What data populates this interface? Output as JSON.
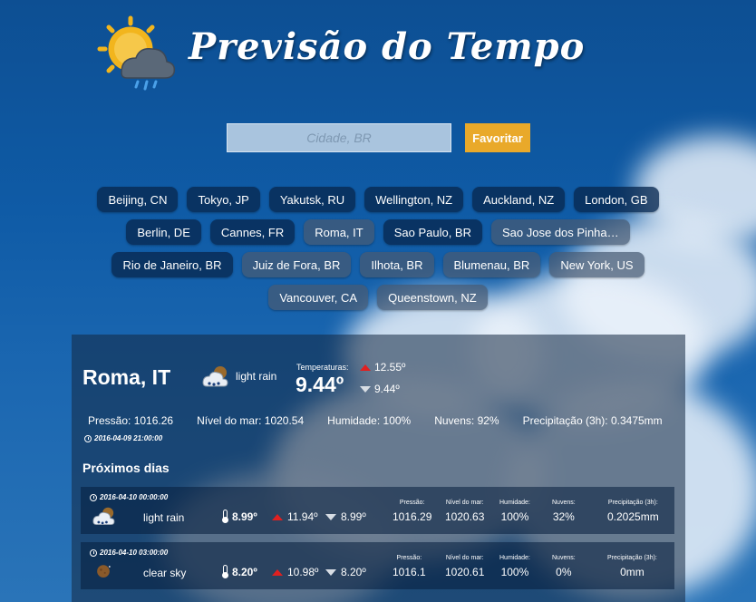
{
  "app": {
    "title": "Previsão do Tempo"
  },
  "search": {
    "placeholder": "Cidade, BR",
    "value": "",
    "favorite_label": "Favoritar"
  },
  "cities": [
    [
      "Beijing, CN",
      "Tokyo, JP",
      "Yakutsk, RU",
      "Wellington, NZ",
      "Auckland, NZ",
      "London, GB"
    ],
    [
      "Berlin, DE",
      "Cannes, FR",
      "Roma, IT",
      "Sao Paulo, BR",
      "Sao Jose dos Pinha…"
    ],
    [
      "Rio de Janeiro, BR",
      "Juiz de Fora, BR",
      "Ilhota, BR",
      "Blumenau, BR",
      "New York, US"
    ],
    [
      "Vancouver, CA",
      "Queenstown, NZ"
    ]
  ],
  "current": {
    "city": "Roma, IT",
    "icon": "light-rain-icon",
    "description": "light rain",
    "temps_label": "Temperaturas:",
    "temp": "9.44º",
    "temp_max": "12.55º",
    "temp_min": "9.44º",
    "stats": {
      "pressure": "Pressão: 1016.26",
      "sea_level": "Nível do mar: 1020.54",
      "humidity": "Humidade: 100%",
      "clouds": "Nuvens: 92%",
      "precip": "Precipitação (3h): 0.3475mm"
    },
    "timestamp": "2016-04-09 21:00:00"
  },
  "forecast": {
    "title": "Próximos dias",
    "labels": {
      "pressure": "Pressão:",
      "sea_level": "Nível do mar:",
      "humidity": "Humidade:",
      "clouds": "Nuvens:",
      "precip": "Precipitação (3h):"
    },
    "rows": [
      {
        "time": "2016-04-10 00:00:00",
        "icon": "light-rain-icon",
        "description": "light rain",
        "temp": "8.99º",
        "max": "11.94º",
        "min": "8.99º",
        "pressure": "1016.29",
        "sea_level": "1020.63",
        "humidity": "100%",
        "clouds": "32%",
        "precip": "0.2025mm"
      },
      {
        "time": "2016-04-10 03:00:00",
        "icon": "clear-sky-night-icon",
        "description": "clear sky",
        "temp": "8.20º",
        "max": "10.98º",
        "min": "8.20º",
        "pressure": "1016.1",
        "sea_level": "1020.61",
        "humidity": "100%",
        "clouds": "0%",
        "precip": "0mm"
      }
    ]
  },
  "colors": {
    "accent": "#e9a92a",
    "background": "#0f5ba6",
    "up_arrow": "#e02020"
  }
}
